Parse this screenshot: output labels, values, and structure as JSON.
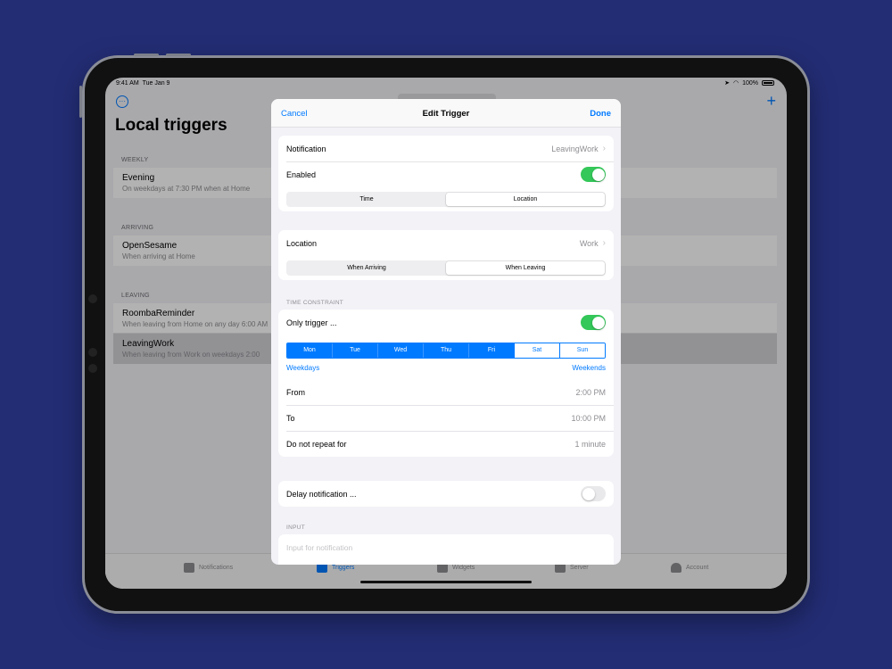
{
  "status_bar": {
    "time": "9:41 AM",
    "date": "Tue Jan 9",
    "battery": "100%"
  },
  "background": {
    "title": "Local triggers",
    "sections": [
      {
        "header": "WEEKLY",
        "rows": [
          {
            "title": "Evening",
            "subtitle": "On weekdays at 7:30 PM when at Home"
          }
        ]
      },
      {
        "header": "ARRIVING",
        "rows": [
          {
            "title": "OpenSesame",
            "subtitle": "When arriving at Home"
          }
        ]
      },
      {
        "header": "LEAVING",
        "rows": [
          {
            "title": "RoombaReminder",
            "subtitle": "When leaving from Home on any day 6:00 AM"
          },
          {
            "title": "LeavingWork",
            "subtitle": "When leaving from Work on weekdays 2:00"
          }
        ]
      }
    ],
    "tabs": [
      {
        "label": "Notifications",
        "icon": "notifications-icon"
      },
      {
        "label": "Triggers",
        "icon": "triggers-icon",
        "active": true
      },
      {
        "label": "Widgets",
        "icon": "widgets-icon"
      },
      {
        "label": "Server",
        "icon": "server-icon"
      },
      {
        "label": "Account",
        "icon": "account-icon"
      }
    ]
  },
  "modal": {
    "cancel": "Cancel",
    "title": "Edit Trigger",
    "done": "Done",
    "notification_label": "Notification",
    "notification_value": "LeavingWork",
    "enabled_label": "Enabled",
    "enabled": true,
    "type_segment": [
      "Time",
      "Location"
    ],
    "type_selected": "Location",
    "location_label": "Location",
    "location_value": "Work",
    "event_segment": [
      "When Arriving",
      "When Leaving"
    ],
    "event_selected": "When Leaving",
    "time_constraint_header": "TIME CONSTRAINT",
    "only_trigger_label": "Only trigger ...",
    "only_trigger": true,
    "days": [
      {
        "label": "Mon",
        "on": true
      },
      {
        "label": "Tue",
        "on": true
      },
      {
        "label": "Wed",
        "on": true
      },
      {
        "label": "Thu",
        "on": true
      },
      {
        "label": "Fri",
        "on": true
      },
      {
        "label": "Sat",
        "on": false
      },
      {
        "label": "Sun",
        "on": false
      }
    ],
    "weekdays_button": "Weekdays",
    "weekends_button": "Weekends",
    "from_label": "From",
    "from_value": "2:00 PM",
    "to_label": "To",
    "to_value": "10:00 PM",
    "repeat_label": "Do not repeat for",
    "repeat_value": "1 minute",
    "delay_label": "Delay notification ...",
    "delay": false,
    "input_header": "INPUT",
    "input_placeholder": "Input for notification"
  },
  "colors": {
    "accent": "#007aff",
    "toggle_on": "#34c759",
    "background": "#232d74"
  }
}
